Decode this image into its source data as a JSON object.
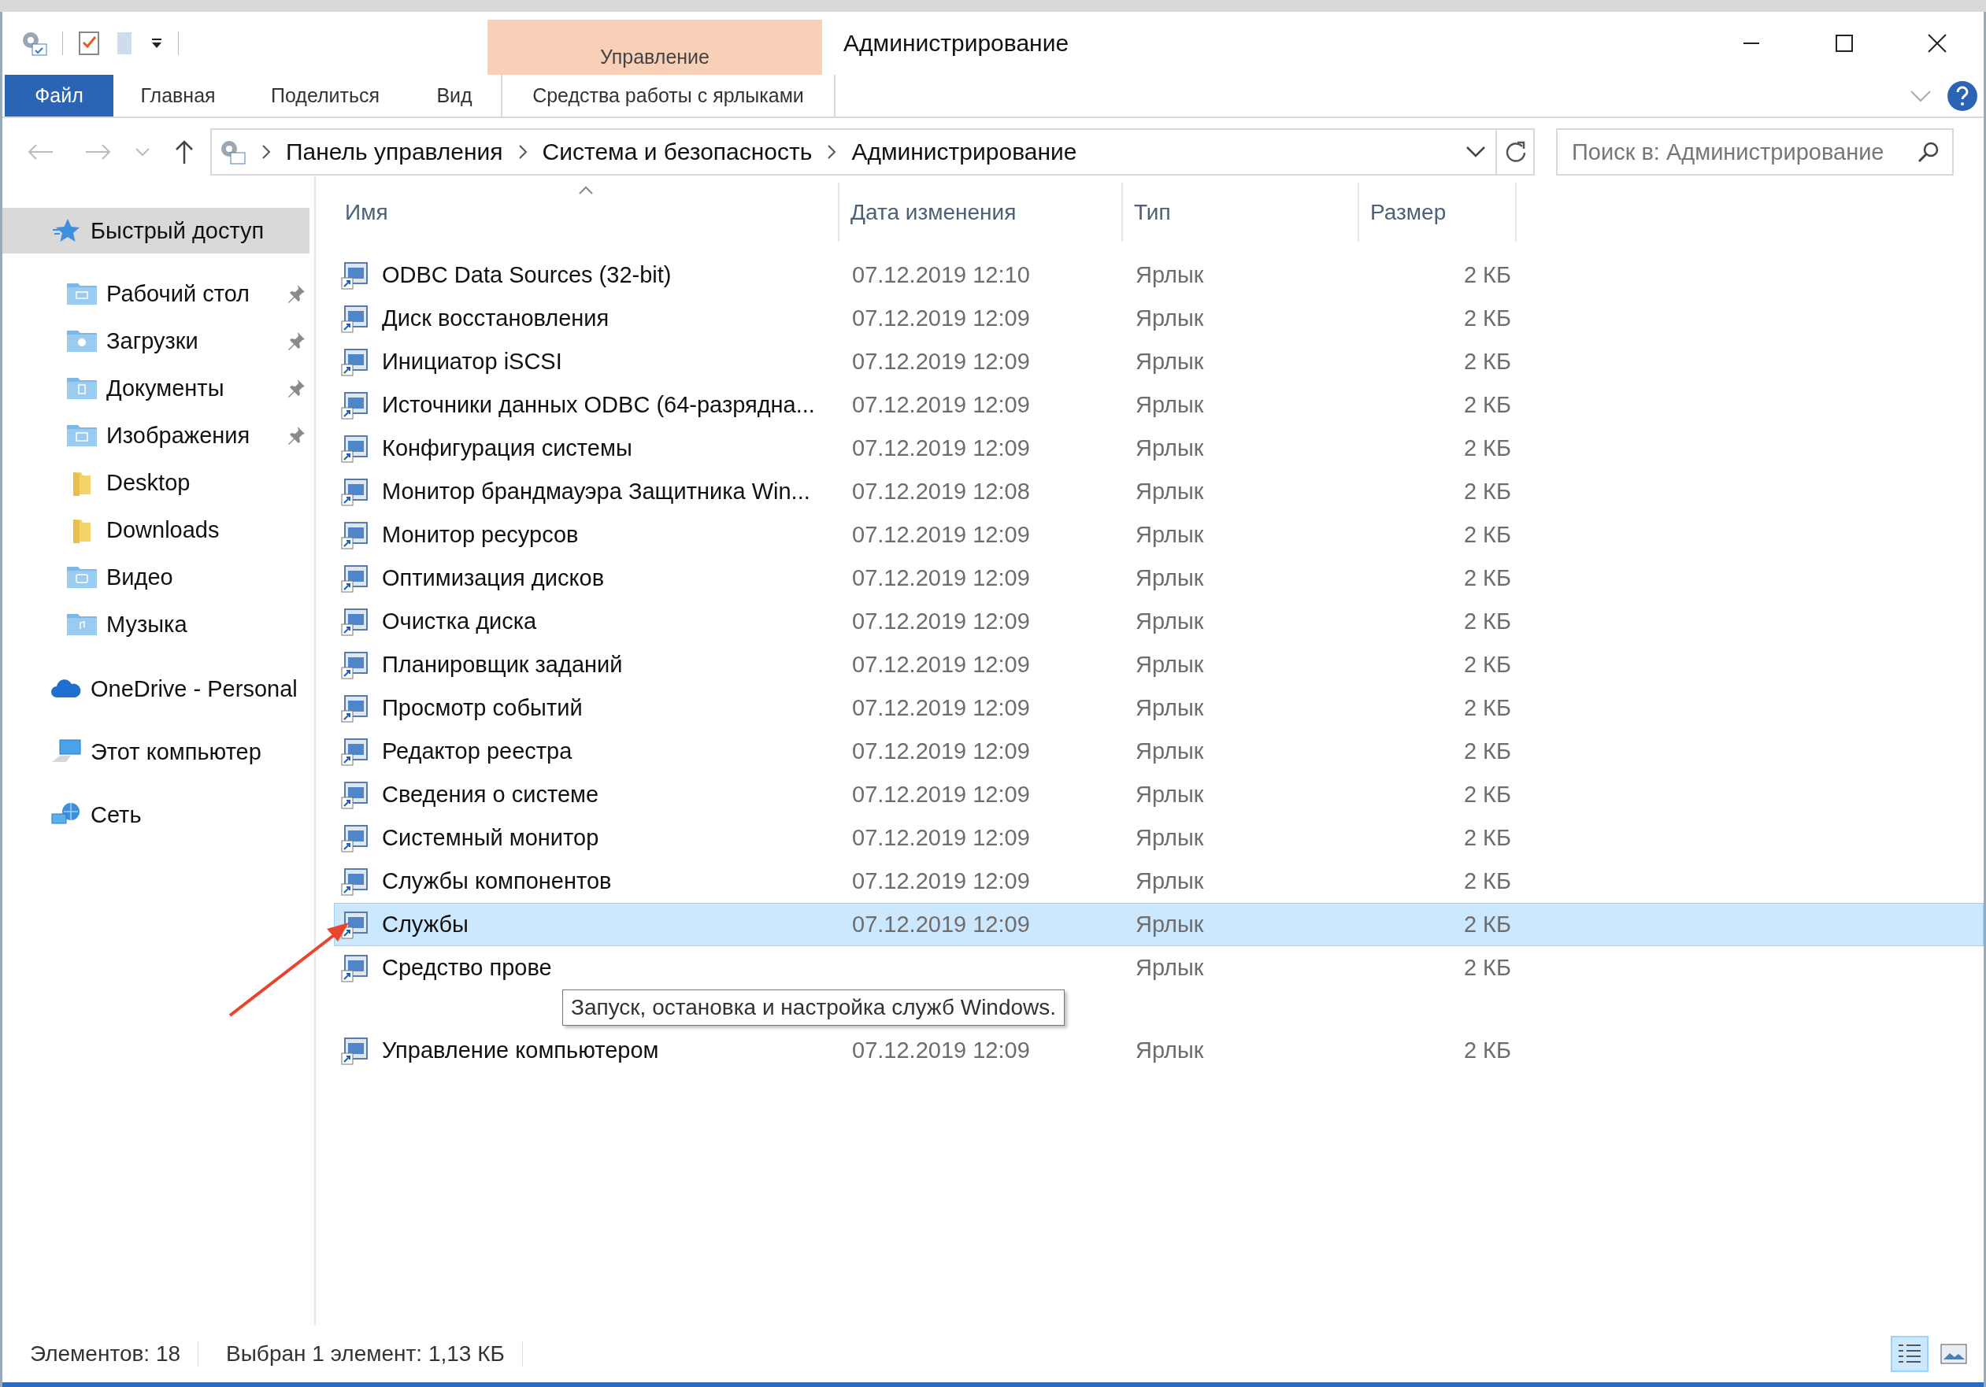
{
  "window": {
    "title": "Администрирование"
  },
  "ribbon": {
    "context_group": "Управление",
    "tabs": [
      {
        "label": "Файл",
        "kind": "file",
        "selected": false
      },
      {
        "label": "Главная",
        "kind": "normal",
        "selected": false
      },
      {
        "label": "Поделиться",
        "kind": "normal",
        "selected": false
      },
      {
        "label": "Вид",
        "kind": "normal",
        "selected": false
      },
      {
        "label": "Средства работы с ярлыками",
        "kind": "context",
        "selected": false
      }
    ]
  },
  "address": {
    "path": [
      "Панель управления",
      "Система и безопасность",
      "Администрирование"
    ]
  },
  "search": {
    "placeholder": "Поиск в: Администрирование"
  },
  "sidebar": {
    "items": [
      {
        "label": "Быстрый доступ",
        "kind": "star",
        "selected": true,
        "children": [
          {
            "label": "Рабочий стол",
            "kind": "folder-desktop",
            "pinned": true,
            "selected": false
          },
          {
            "label": "Загрузки",
            "kind": "folder-downloads",
            "pinned": true,
            "selected": false
          },
          {
            "label": "Документы",
            "kind": "folder-documents",
            "pinned": true,
            "selected": false
          },
          {
            "label": "Изображения",
            "kind": "folder-pictures",
            "pinned": true,
            "selected": false
          },
          {
            "label": "Desktop",
            "kind": "folder-plain",
            "pinned": false,
            "selected": false
          },
          {
            "label": "Downloads",
            "kind": "folder-plain",
            "pinned": false,
            "selected": false
          },
          {
            "label": "Видео",
            "kind": "folder-videos",
            "pinned": false,
            "selected": false
          },
          {
            "label": "Музыка",
            "kind": "folder-music",
            "pinned": false,
            "selected": false
          }
        ]
      },
      {
        "label": "OneDrive - Personal",
        "kind": "cloud",
        "selected": false
      },
      {
        "label": "Этот компьютер",
        "kind": "computer",
        "selected": false
      },
      {
        "label": "Сеть",
        "kind": "network",
        "selected": false
      }
    ]
  },
  "table": {
    "columns": [
      {
        "label": "Имя",
        "sorted": true
      },
      {
        "label": "Дата изменения",
        "sorted": false
      },
      {
        "label": "Тип",
        "sorted": false
      },
      {
        "label": "Размер",
        "sorted": false
      }
    ],
    "rows": [
      {
        "name": "ODBC Data Sources (32-bit)",
        "date": "07.12.2019 12:10",
        "type": "Ярлык",
        "size": "2 КБ",
        "selected": false
      },
      {
        "name": "Диск восстановления",
        "date": "07.12.2019 12:09",
        "type": "Ярлык",
        "size": "2 КБ",
        "selected": false
      },
      {
        "name": "Инициатор iSCSI",
        "date": "07.12.2019 12:09",
        "type": "Ярлык",
        "size": "2 КБ",
        "selected": false
      },
      {
        "name": "Источники данных ODBC (64-разрядна...",
        "date": "07.12.2019 12:09",
        "type": "Ярлык",
        "size": "2 КБ",
        "selected": false
      },
      {
        "name": "Конфигурация системы",
        "date": "07.12.2019 12:09",
        "type": "Ярлык",
        "size": "2 КБ",
        "selected": false
      },
      {
        "name": "Монитор брандмауэра Защитника Win...",
        "date": "07.12.2019 12:08",
        "type": "Ярлык",
        "size": "2 КБ",
        "selected": false
      },
      {
        "name": "Монитор ресурсов",
        "date": "07.12.2019 12:09",
        "type": "Ярлык",
        "size": "2 КБ",
        "selected": false
      },
      {
        "name": "Оптимизация дисков",
        "date": "07.12.2019 12:09",
        "type": "Ярлык",
        "size": "2 КБ",
        "selected": false
      },
      {
        "name": "Очистка диска",
        "date": "07.12.2019 12:09",
        "type": "Ярлык",
        "size": "2 КБ",
        "selected": false
      },
      {
        "name": "Планировщик заданий",
        "date": "07.12.2019 12:09",
        "type": "Ярлык",
        "size": "2 КБ",
        "selected": false
      },
      {
        "name": "Просмотр событий",
        "date": "07.12.2019 12:09",
        "type": "Ярлык",
        "size": "2 КБ",
        "selected": false
      },
      {
        "name": "Редактор реестра",
        "date": "07.12.2019 12:09",
        "type": "Ярлык",
        "size": "2 КБ",
        "selected": false
      },
      {
        "name": "Сведения о системе",
        "date": "07.12.2019 12:09",
        "type": "Ярлык",
        "size": "2 КБ",
        "selected": false
      },
      {
        "name": "Системный монитор",
        "date": "07.12.2019 12:09",
        "type": "Ярлык",
        "size": "2 КБ",
        "selected": false
      },
      {
        "name": "Службы компонентов",
        "date": "07.12.2019 12:09",
        "type": "Ярлык",
        "size": "2 КБ",
        "selected": false
      },
      {
        "name": "Службы",
        "date": "07.12.2019 12:09",
        "type": "Ярлык",
        "size": "2 КБ",
        "selected": true
      },
      {
        "name": "Средство прове",
        "type": "Ярлык",
        "size": "2 КБ",
        "selected": false,
        "tooltip": "Запуск, остановка и настройка служб Windows."
      },
      {
        "name": "Управление компьютером",
        "date": "07.12.2019 12:09",
        "type": "Ярлык",
        "size": "2 КБ",
        "selected": false
      }
    ]
  },
  "status_bar": {
    "items": [
      "Элементов: 18",
      "Выбран 1 элемент: 1,13 КБ"
    ],
    "views": [
      {
        "kind": "details",
        "selected": true
      },
      {
        "kind": "tiles",
        "selected": false
      }
    ]
  }
}
